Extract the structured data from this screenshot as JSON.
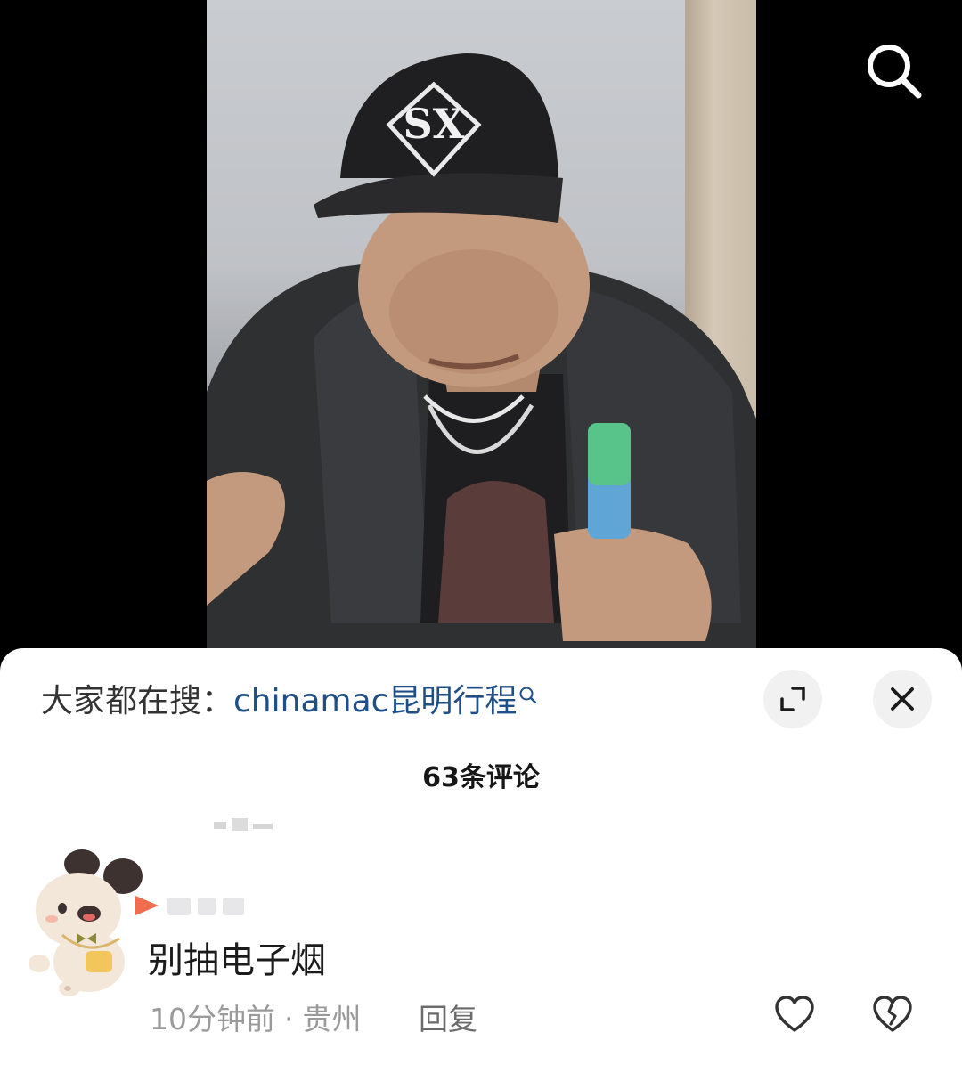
{
  "video": {
    "search_icon": "search-icon"
  },
  "sheet": {
    "trending_prefix": "大家都在搜：",
    "trending_query": "chinamac昆明行程",
    "expand_icon": "expand-icon",
    "close_icon": "close-icon",
    "comment_count": "63条评论"
  },
  "comment": {
    "text": "别抽电子烟",
    "time": "10分钟前",
    "separator": "·",
    "location": "贵州",
    "reply_label": "回复",
    "like_icon": "heart-icon",
    "dislike_icon": "broken-heart-icon"
  },
  "colors": {
    "link": "#1f4f86",
    "meta": "#9a9a9a",
    "sheet_bg": "#ffffff",
    "button_bg": "#f1f1f2"
  }
}
